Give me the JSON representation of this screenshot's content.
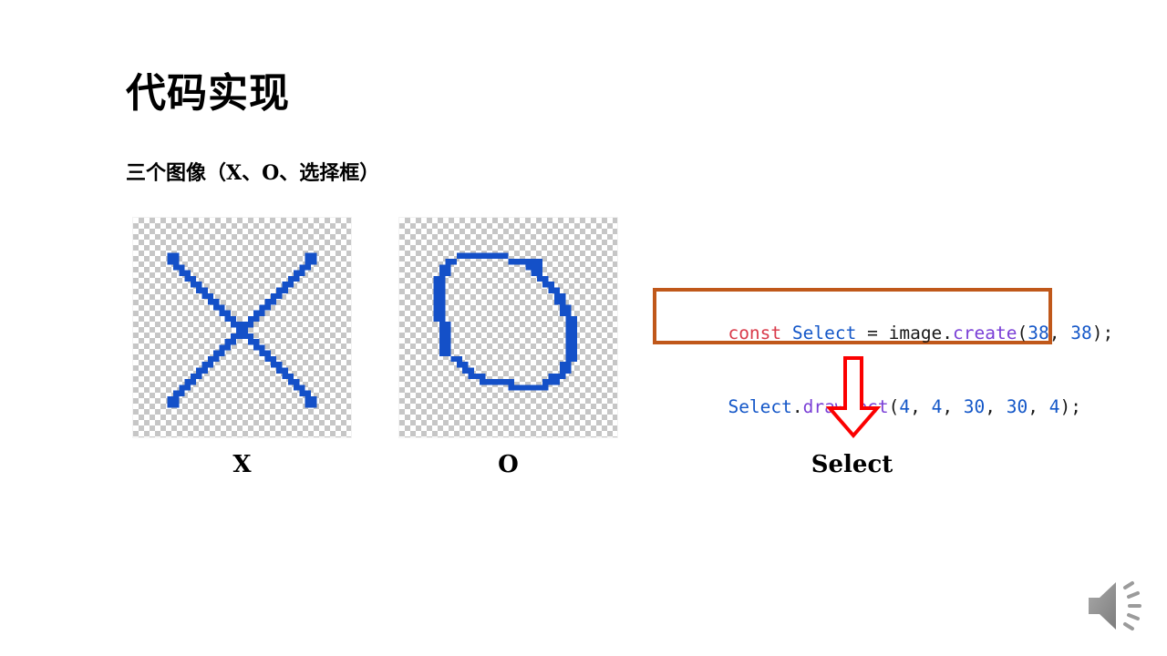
{
  "slide": {
    "background_color": "#ffffff",
    "title": "代码实现",
    "subtitle": "三个图像（X、O、选择框）"
  },
  "sprites": [
    {
      "id": "x",
      "caption": "X",
      "icon_name": "pixel-art-x-sprite",
      "pixel_color": "#1450c8",
      "checker_color": "#c6c6c6",
      "grid_size": 38
    },
    {
      "id": "o",
      "caption": "O",
      "icon_name": "pixel-art-o-sprite",
      "pixel_color": "#1450c8",
      "checker_color": "#c6c6c6",
      "grid_size": 38
    }
  ],
  "select": {
    "caption": "Select",
    "arrow_color": "#fb0000",
    "code": {
      "border_color": "#c0581a",
      "background_color": "#ffffff",
      "lines": [
        {
          "tokens": [
            {
              "text": "const",
              "kind": "keyword"
            },
            {
              "text": " ",
              "kind": "plain"
            },
            {
              "text": "Select",
              "kind": "identifier"
            },
            {
              "text": " = ",
              "kind": "plain"
            },
            {
              "text": "image",
              "kind": "plain"
            },
            {
              "text": ".",
              "kind": "plain"
            },
            {
              "text": "create",
              "kind": "function"
            },
            {
              "text": "(",
              "kind": "plain"
            },
            {
              "text": "38",
              "kind": "number"
            },
            {
              "text": ", ",
              "kind": "plain"
            },
            {
              "text": "38",
              "kind": "number"
            },
            {
              "text": ");",
              "kind": "plain"
            }
          ]
        },
        {
          "tokens": [
            {
              "text": "Select",
              "kind": "identifier"
            },
            {
              "text": ".",
              "kind": "plain"
            },
            {
              "text": "drawRect",
              "kind": "function"
            },
            {
              "text": "(",
              "kind": "plain"
            },
            {
              "text": "4",
              "kind": "number"
            },
            {
              "text": ", ",
              "kind": "plain"
            },
            {
              "text": "4",
              "kind": "number"
            },
            {
              "text": ", ",
              "kind": "plain"
            },
            {
              "text": "30",
              "kind": "number"
            },
            {
              "text": ", ",
              "kind": "plain"
            },
            {
              "text": "30",
              "kind": "number"
            },
            {
              "text": ", ",
              "kind": "plain"
            },
            {
              "text": "4",
              "kind": "number"
            },
            {
              "text": ");",
              "kind": "plain"
            }
          ]
        }
      ],
      "colors": {
        "keyword": "#d93a4a",
        "identifier": "#1457c8",
        "function": "#7a3fd6",
        "number": "#1457c8",
        "plain": "#1a1a1a"
      }
    }
  },
  "media": {
    "speaker_icon_name": "speaker-audio-icon",
    "speaker_color": "#9b9b9b"
  }
}
